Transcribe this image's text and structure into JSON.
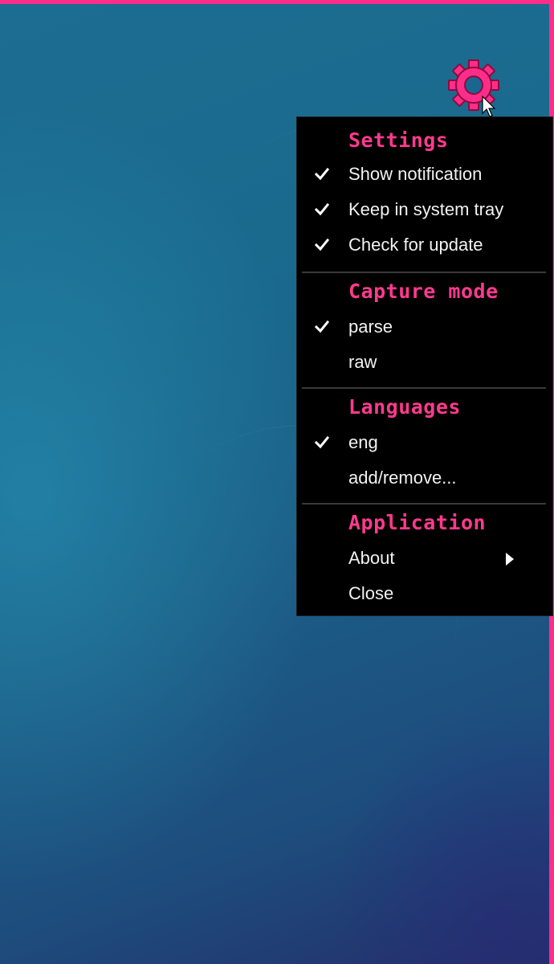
{
  "colors": {
    "accent": "#ff2d8a",
    "menu_background": "#000000",
    "menu_text": "#f2f2f2",
    "desktop_blue": "#1c6a8f"
  },
  "icons": {
    "gear": "gear-icon",
    "cursor": "mouse-pointer-icon",
    "check": "checkmark-icon",
    "submenu": "submenu-arrow-icon"
  },
  "menu": {
    "sections": [
      {
        "title": "Settings",
        "items": [
          {
            "label": "Show notification",
            "checked": true
          },
          {
            "label": "Keep in system tray",
            "checked": true
          },
          {
            "label": "Check for update",
            "checked": true
          }
        ]
      },
      {
        "title": "Capture mode",
        "items": [
          {
            "label": "parse",
            "checked": true
          },
          {
            "label": "raw",
            "checked": false
          }
        ]
      },
      {
        "title": "Languages",
        "items": [
          {
            "label": "eng",
            "checked": true
          },
          {
            "label": "add/remove...",
            "checked": false
          }
        ]
      },
      {
        "title": "Application",
        "items": [
          {
            "label": "About",
            "checked": false,
            "submenu": true
          },
          {
            "label": "Close",
            "checked": false
          }
        ]
      }
    ]
  }
}
